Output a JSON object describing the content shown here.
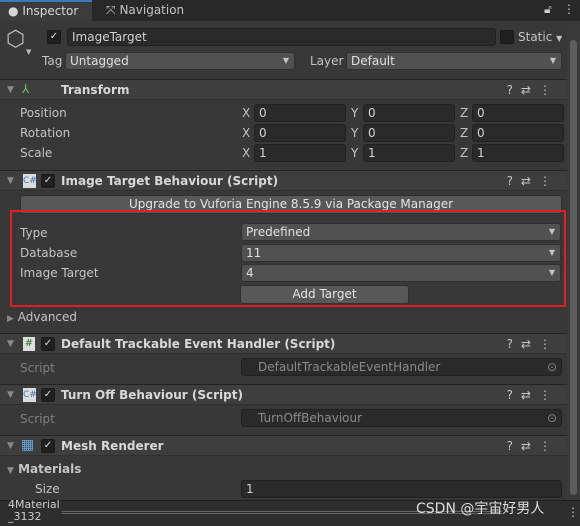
{
  "tabs": [
    {
      "label": "Inspector",
      "icon": "info-icon"
    },
    {
      "label": "Navigation",
      "icon": "navigation-icon"
    }
  ],
  "object": {
    "name": "ImageTarget",
    "active": true,
    "static_label": "Static",
    "static": false,
    "tag_label": "Tag",
    "tag": "Untagged",
    "layer_label": "Layer",
    "layer": "Default"
  },
  "transform": {
    "title": "Transform",
    "rows": [
      {
        "label": "Position",
        "x": "0",
        "y": "0",
        "z": "0"
      },
      {
        "label": "Rotation",
        "x": "0",
        "y": "0",
        "z": "0"
      },
      {
        "label": "Scale",
        "x": "1",
        "y": "1",
        "z": "1"
      }
    ],
    "axes": {
      "x": "X",
      "y": "Y",
      "z": "Z"
    }
  },
  "itb": {
    "title": "Image Target Behaviour (Script)",
    "upgrade": "Upgrade to Vuforia Engine 8.5.9 via Package Manager",
    "type_label": "Type",
    "type": "Predefined",
    "database_label": "Database",
    "database": "11",
    "image_target_label": "Image Target",
    "image_target": "4",
    "add_target": "Add Target",
    "advanced": "Advanced",
    "highlight_color": "#e02020"
  },
  "dteh": {
    "title": "Default Trackable Event Handler (Script)",
    "script_label": "Script",
    "script": "DefaultTrackableEventHandler"
  },
  "turnoff": {
    "title": "Turn Off Behaviour (Script)",
    "script_label": "Script",
    "script": "TurnOffBehaviour"
  },
  "mesh": {
    "title": "Mesh Renderer",
    "materials": "Materials",
    "size_label": "Size",
    "size": "1"
  },
  "bottom": {
    "line1": "4Material",
    "line2": "_3132"
  },
  "watermark": "CSDN @宇宙好男人"
}
